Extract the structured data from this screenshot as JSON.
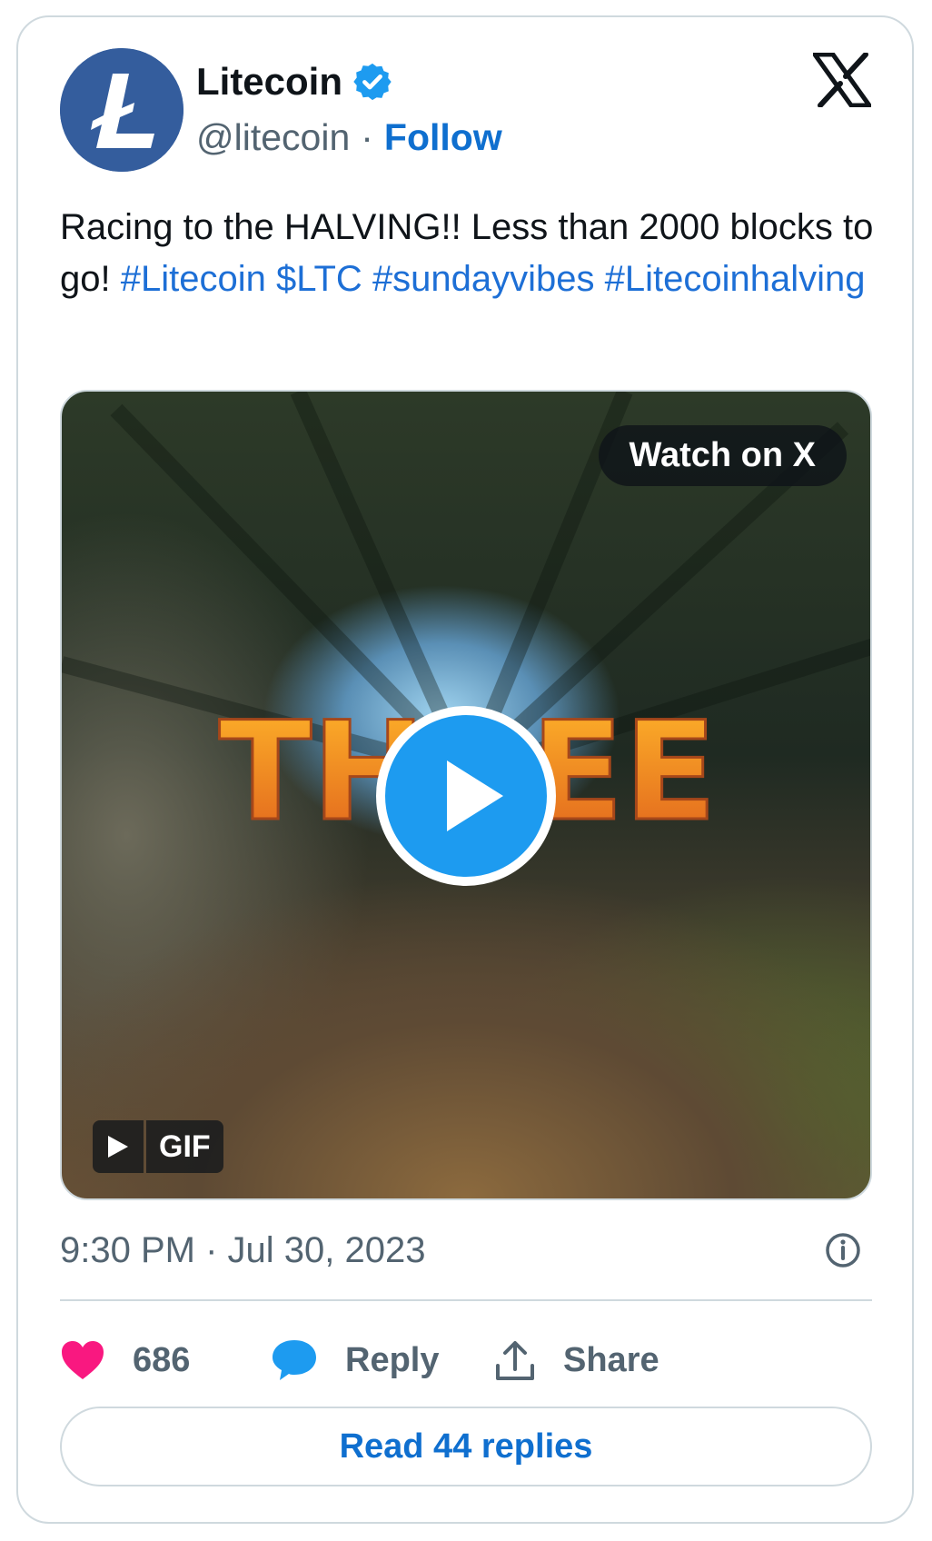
{
  "account": {
    "name": "Litecoin",
    "handle": "@litecoin",
    "separator": "·",
    "follow_label": "Follow"
  },
  "tweet": {
    "text_plain": "Racing to the HALVING!! Less than 2000 blocks to go! ",
    "hashtags": [
      "#Litecoin",
      "$LTC",
      "#sundayvibes",
      "#Litecoinhalving"
    ]
  },
  "media": {
    "watch_label": "Watch on X",
    "gif_label": "GIF",
    "overlay_text": "THREE"
  },
  "footer": {
    "timestamp": "9:30 PM · Jul 30, 2023",
    "likes": "686",
    "reply_label": "Reply",
    "share_label": "Share",
    "read_replies_label": "Read 44 replies"
  },
  "colors": {
    "accent": "#1d9bf0",
    "link": "#1d6fd6",
    "heart": "#f91880",
    "avatar_bg": "#345d9d"
  },
  "icons": [
    "litecoin-logo-icon",
    "verified-badge-icon",
    "x-logo-icon",
    "play-icon",
    "info-icon",
    "heart-icon",
    "reply-bubble-icon",
    "share-icon"
  ]
}
